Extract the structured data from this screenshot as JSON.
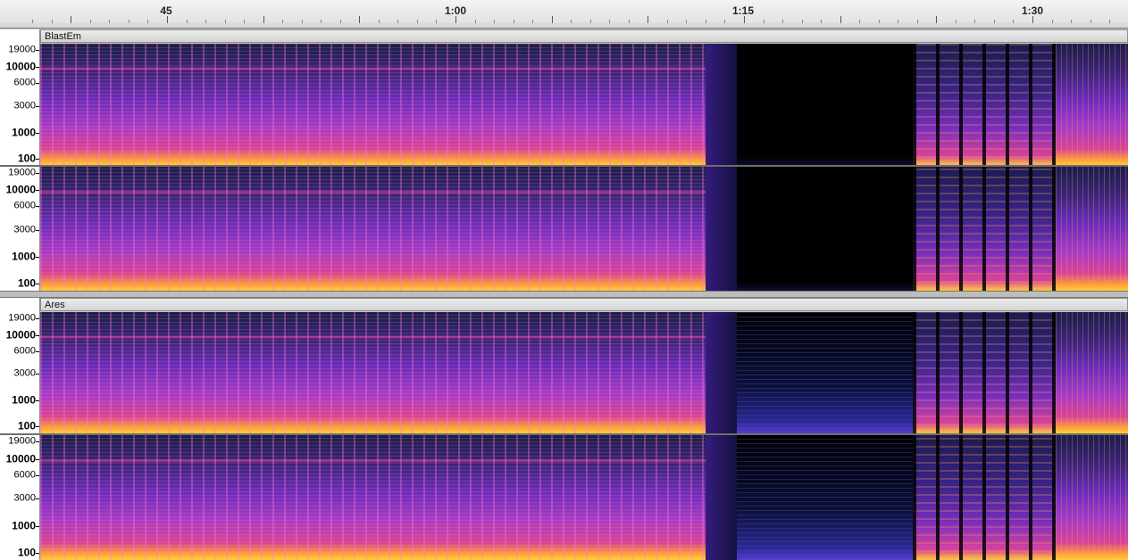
{
  "ruler": {
    "labels": [
      "45",
      "1:00",
      "1:15",
      "1:30"
    ]
  },
  "tracks": [
    {
      "name": "BlastEm",
      "variant": "silent-gap"
    },
    {
      "name": "Ares",
      "variant": "noisy-gap"
    }
  ],
  "frequency_scale": [
    "19000",
    "10000",
    "6000",
    "3000",
    "1000",
    "100"
  ],
  "palette": {
    "silence": "#000000",
    "low_energy": "#1b1c4f",
    "mid_energy": "#6a2bbd",
    "high_energy": "#d9429a",
    "peak": "#ffd23a"
  }
}
